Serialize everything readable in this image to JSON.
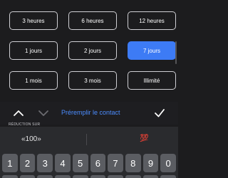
{
  "duration_options": [
    {
      "label": "3 heures",
      "selected": false
    },
    {
      "label": "6 heures",
      "selected": false
    },
    {
      "label": "12 heures",
      "selected": false
    },
    {
      "label": "1 jours",
      "selected": false
    },
    {
      "label": "2 jours",
      "selected": false
    },
    {
      "label": "7 jours",
      "selected": true
    },
    {
      "label": "1 mois",
      "selected": false
    },
    {
      "label": "3 mois",
      "selected": false
    },
    {
      "label": "Illimité",
      "selected": false
    }
  ],
  "toolbar": {
    "prefill_label": "Préremplir le contact",
    "up_icon": "chevron-up-icon",
    "down_icon": "chevron-down-icon",
    "done_icon": "checkmark-icon"
  },
  "section_label": "RÉDUCTION SUR",
  "keyboard": {
    "suggestion": "«100»",
    "emoji": "💯",
    "keys": [
      "1",
      "2",
      "3",
      "4",
      "5",
      "6",
      "7",
      "8",
      "9",
      "0"
    ]
  },
  "colors": {
    "accent": "#3d7bf5",
    "background": "#1c1c1e",
    "keyboard": "#2a2b2e"
  }
}
